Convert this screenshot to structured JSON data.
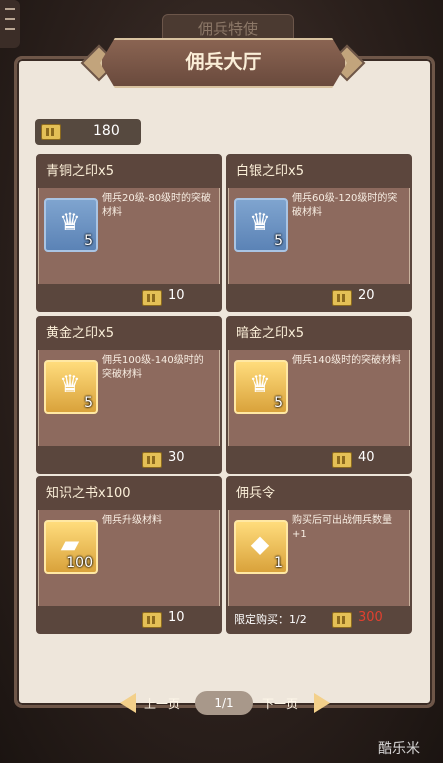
{
  "header": {
    "top_banner": "佣兵特使",
    "title": "佣兵大厅"
  },
  "currency": {
    "amount": "180"
  },
  "cards": [
    {
      "name": "青铜之印x5",
      "desc": "佣兵20级-80级时的突破材料",
      "count": "5",
      "price": "10",
      "icon": "bronze-seal-icon",
      "frame": "blue"
    },
    {
      "name": "白银之印x5",
      "desc": "佣兵60级-120级时的突破材料",
      "count": "5",
      "price": "20",
      "icon": "silver-seal-icon",
      "frame": "blue"
    },
    {
      "name": "黄金之印x5",
      "desc": "佣兵100级-140级时的突破材料",
      "count": "5",
      "price": "30",
      "icon": "gold-seal-icon",
      "frame": "gold"
    },
    {
      "name": "暗金之印x5",
      "desc": "佣兵140级时的突破材料",
      "count": "5",
      "price": "40",
      "icon": "dark-gold-seal-icon",
      "frame": "gold"
    },
    {
      "name": "知识之书x100",
      "desc": "佣兵升级材料",
      "count": "100",
      "price": "10",
      "icon": "book-icon",
      "frame": "gold"
    },
    {
      "name": "佣兵令",
      "desc": "购买后可出战佣兵数量+1",
      "count": "1",
      "price": "300",
      "limit": "限定购买：1/2",
      "icon": "mercenary-token-icon",
      "frame": "gold"
    }
  ],
  "pager": {
    "prev": "上一页",
    "page": "1/1",
    "next": "下一页"
  },
  "watermark": "酷乐米",
  "colors": {
    "panel": "#eee6db",
    "card": "#8d6a5e",
    "price_alert": "#e0402f"
  }
}
